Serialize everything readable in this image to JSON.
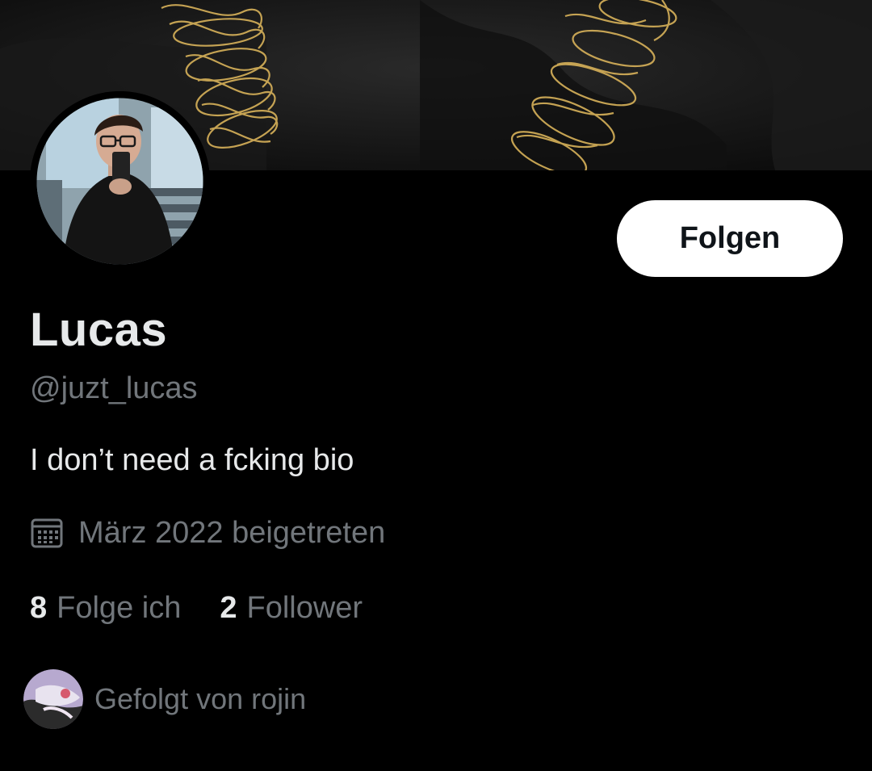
{
  "profile": {
    "display_name": "Lucas",
    "handle": "@juzt_lucas",
    "bio": "I don’t need a fcking bio",
    "joined": "März 2022 beigetreten"
  },
  "actions": {
    "follow_label": "Folgen"
  },
  "stats": {
    "following_count": "8",
    "following_label": "Folge ich",
    "followers_count": "2",
    "followers_label": "Follower"
  },
  "followed_by": {
    "text": "Gefolgt von rojin"
  },
  "icons": {
    "calendar": "calendar-icon",
    "avatar": "profile-photo",
    "banner": "header-image"
  },
  "colors": {
    "background": "#000000",
    "primary_text": "#e7e9ea",
    "secondary_text": "#71767b",
    "button_bg": "#ffffff",
    "button_text": "#0f1419",
    "banner_accent": "#d8b25a"
  }
}
